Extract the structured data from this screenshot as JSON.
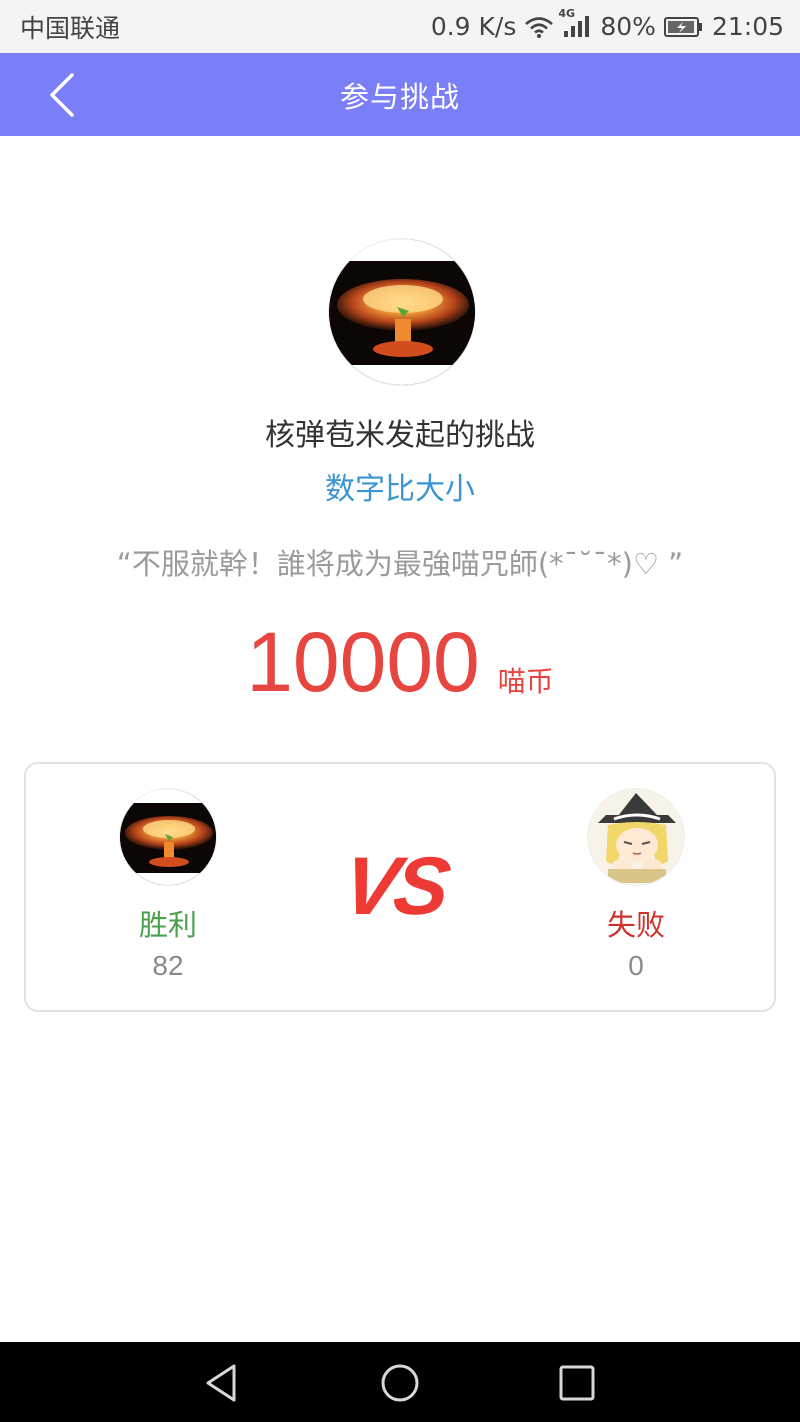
{
  "status_bar": {
    "carrier": "中国联通",
    "net_speed": "0.9 K/s",
    "network_type": "4G",
    "battery": "80%",
    "time": "21:05"
  },
  "header": {
    "title": "参与挑战",
    "back_icon": "chevron-left-icon"
  },
  "challenge": {
    "title": "核弹苞米发起的挑战",
    "game_type": "数字比大小",
    "quote": "“不服就幹！誰将成为最強喵咒師(*ˉ˘ˉ*)♡ ”",
    "stake_amount": "10000",
    "stake_unit": "喵币"
  },
  "vs": {
    "label": "VS",
    "winner": {
      "result": "胜利",
      "score": "82"
    },
    "loser": {
      "result": "失败",
      "score": "0"
    }
  },
  "nav_bar": {
    "icons": [
      "nav-back-icon",
      "nav-home-icon",
      "nav-recent-icon"
    ]
  },
  "colors": {
    "header_bg": "#7b7ff7",
    "game_type": "#3a95d2",
    "stake": "#e6463f",
    "win": "#4aa04f",
    "lose": "#d0312d"
  }
}
